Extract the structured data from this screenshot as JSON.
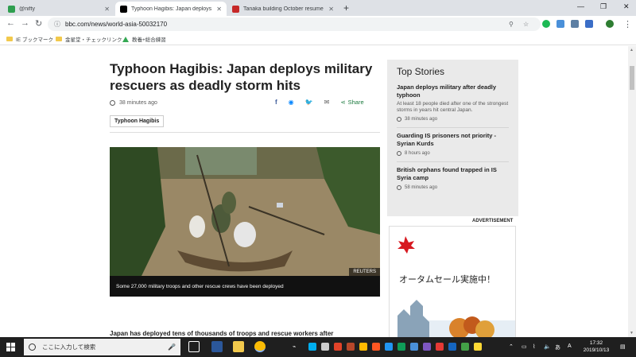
{
  "browser": {
    "tabs": [
      {
        "label": "@nifty",
        "favicon_color": "#2e9e4f",
        "active": false
      },
      {
        "label": "Typhoon Hagibis: Japan deploys",
        "favicon_color": "#000000",
        "active": true
      },
      {
        "label": "Tanaka building October resume",
        "favicon_color": "#c62828",
        "active": false
      }
    ],
    "url": "bbc.com/news/world-asia-50032170",
    "bookmarks": [
      {
        "label": "IE ブックマーク"
      },
      {
        "label": "金星堂・チェックリンク"
      },
      {
        "label": "教養+総合練習"
      }
    ]
  },
  "article": {
    "headline": "Typhoon Hagibis: Japan deploys military rescuers as deadly storm hits",
    "time": "38 minutes ago",
    "share_label": "Share",
    "tag": "Typhoon Hagibis",
    "image_credit": "REUTERS",
    "image_caption": "Some 27,000 military troops and other rescue crews have been deployed",
    "lead": "Japan has deployed tens of thousands of troops and rescue workers after"
  },
  "top_stories": {
    "heading": "Top Stories",
    "items": [
      {
        "title": "Japan deploys military after deadly typhoon",
        "summary": "At least 18 people died after one of the strongest storms in years hit central Japan.",
        "time": "38 minutes ago"
      },
      {
        "title": "Guarding IS prisoners not priority - Syrian Kurds",
        "summary": "",
        "time": "8 hours ago"
      },
      {
        "title": "British orphans found trapped in IS Syria camp",
        "summary": "",
        "time": "58 minutes ago"
      }
    ]
  },
  "ad": {
    "label": "ADVERTISEMENT",
    "text": "オータムセール実施中！"
  },
  "taskbar": {
    "search_placeholder": "ここに入力して検索",
    "time": "17:32",
    "date": "2019/10/13"
  }
}
